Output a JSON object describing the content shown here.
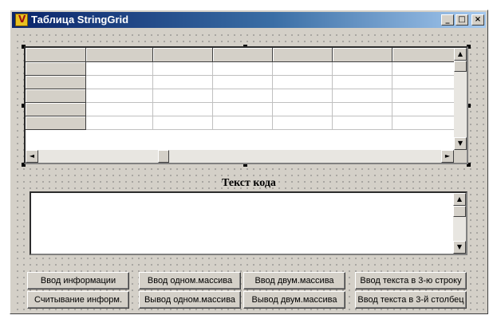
{
  "window": {
    "title": "Таблица StringGrid",
    "caption_buttons": {
      "minimize": "_",
      "maximize": "□",
      "close": "×"
    }
  },
  "grid": {
    "columns": 7,
    "rows": 6,
    "cells": [
      [
        "",
        "",
        "",
        "",
        "",
        "",
        ""
      ],
      [
        "",
        "",
        "",
        "",
        "",
        "",
        ""
      ],
      [
        "",
        "",
        "",
        "",
        "",
        "",
        ""
      ],
      [
        "",
        "",
        "",
        "",
        "",
        "",
        ""
      ],
      [
        "",
        "",
        "",
        "",
        "",
        "",
        ""
      ],
      [
        "",
        "",
        "",
        "",
        "",
        "",
        ""
      ]
    ]
  },
  "code_section": {
    "label": "Текст кода",
    "memo_text": ""
  },
  "buttons": {
    "input_info": "Ввод информации",
    "read_info": "Считывание информ.",
    "input_1d": "Ввод одном.массива",
    "output_1d": "Вывод одном.массива",
    "input_2d": "Ввод двум.массива",
    "output_2d": "Вывод двум.массива",
    "input_row3": "Ввод текста в 3-ю строку",
    "input_col3": "Ввод текста в 3-й столбец"
  },
  "scroll_arrows": {
    "up": "▲",
    "down": "▼",
    "left": "◄",
    "right": "►"
  }
}
